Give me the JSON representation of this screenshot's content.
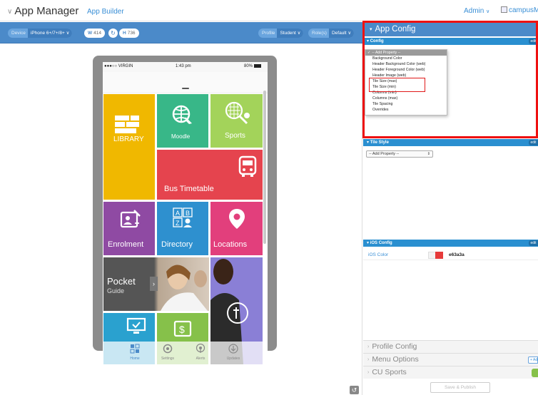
{
  "header": {
    "title": "App Manager",
    "subtitle": "App Builder",
    "admin": "Admin",
    "brand": "campusM"
  },
  "toolbar": {
    "device_key": "Device",
    "device_val": "iPhone 6+/7+/8+",
    "width_key": "W",
    "width_val": "414",
    "height_key": "H",
    "height_val": "736",
    "profile_key": "Profile",
    "profile_val": "Student",
    "roles_key": "Role(s)",
    "roles_val": "Default"
  },
  "phone": {
    "carrier": "●●●○○ VIRGIN",
    "time": "1:43 pm",
    "battery": "80%",
    "tiles": {
      "library": "LIBRARY",
      "moodle": "Moodle",
      "sports": "Sports",
      "bus": "Bus Timetable",
      "enrolment": "Enrolment",
      "directory": "Directory",
      "locations": "Locations",
      "pocket_title": "Pocket",
      "pocket_sub": "Guide"
    },
    "tabs": [
      "Home",
      "Settings",
      "Alerts",
      "Updates"
    ]
  },
  "panel": {
    "title": "App Config",
    "config_label": "Config",
    "edit_label": "edit",
    "dropdown_items": [
      "-- Add Property --",
      "Background Color",
      "Header Background Color (web)",
      "Header Foreground Color (web)",
      "Header Image (web)",
      "Tile Size (max)",
      "Tile Size (min)",
      "Columns (min)",
      "Columns (max)",
      "Tile Spacing",
      "Overrides"
    ],
    "tile_style_label": "Tile Style",
    "add_property": "-- Add Property --",
    "ios_config_label": "iOS Config",
    "ios_color_label": "iOS Color",
    "ios_color_value": "e63a3a",
    "sections": [
      "Profile Config",
      "Menu Options",
      "CU Sports"
    ],
    "add_label": "+ Add",
    "save_publish": "Save & Publish"
  },
  "colors": {
    "accent": "#4b8ac9",
    "panel_sub": "#2a8fd0",
    "highlight": "#ee1111",
    "library": "#f0b800",
    "moodle": "#38b788",
    "sports": "#a3d35a",
    "bus": "#e5444e",
    "enrolment": "#8f4aa3",
    "directory": "#2e90cf",
    "locations": "#e23f7c",
    "pocket": "#555555"
  }
}
